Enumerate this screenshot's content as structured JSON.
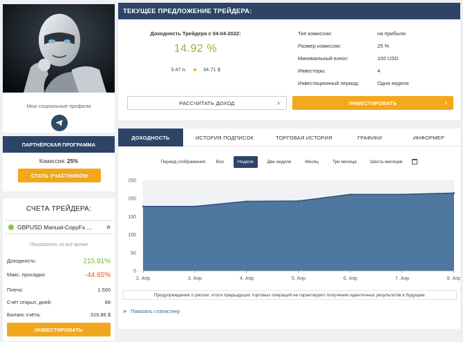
{
  "profile": {
    "social_label": "Мои социальные профили",
    "telegram_icon": "telegram-icon"
  },
  "partner": {
    "title": "ПАРТНЁРСКАЯ ПРОГРАММА",
    "commission_label": "Комиссия:",
    "commission_value": "25%",
    "join_label": "СТАТЬ УЧАСТНИКОМ"
  },
  "accounts": {
    "title": "СЧЕТА ТРЕЙДЕРА:",
    "account_name": "GBPUSD Manual-CopyFx ...",
    "account_arrow": "»",
    "metrics_caption": "Показатели за всё время",
    "metrics": {
      "yield": {
        "label": "Доходность:",
        "value": "215.91%"
      },
      "drawdown": {
        "label": "Макс. просадка:",
        "value": "-44.65%"
      },
      "leverage": {
        "label": "Плечо:",
        "value": "1:500"
      },
      "days": {
        "label": "Счёт открыт, дней:",
        "value": "68"
      },
      "balance": {
        "label": "Баланс счёта:",
        "value": "316.86 $"
      }
    },
    "invest_label": "ИНВЕСТИРОВАТЬ"
  },
  "offer": {
    "title": "ТЕКУЩЕЕ ПРЕДЛОЖЕНИЕ ТРЕЙДЕРА:",
    "yield_label": "Доходность Трейдера с 04-04-2022:",
    "yield_value": "14.92 %",
    "points": "3.47 п.",
    "usd": "34.71 $",
    "details": [
      {
        "k": "Тип комиссии:",
        "v": "на прибыли"
      },
      {
        "k": "Размер комиссии:",
        "v": "25 %"
      },
      {
        "k": "Минимальный взнос:",
        "v": "100 USD"
      },
      {
        "k": "Инвесторы:",
        "v": "4"
      },
      {
        "k": "Инвестиционный период:",
        "v": "Одна неделя"
      }
    ],
    "calc_label": "РАССЧИТАТЬ ДОХОД",
    "invest_label": "ИНВЕСТИРОВАТЬ",
    "chevron": "›"
  },
  "tabs": [
    {
      "label": "ДОХОДНОСТЬ",
      "active": true
    },
    {
      "label": "ИСТОРИЯ ПОДПИСОК",
      "active": false
    },
    {
      "label": "ТОРГОВАЯ ИСТОРИЯ",
      "active": false
    },
    {
      "label": "ГРАФИКИ",
      "active": false
    },
    {
      "label": "ИНФОРМЕР",
      "active": false
    }
  ],
  "periods": {
    "label": "Период отображения:",
    "options": [
      {
        "label": "Все",
        "active": false
      },
      {
        "label": "Неделя",
        "active": true
      },
      {
        "label": "Две недели",
        "active": false
      },
      {
        "label": "Месяц",
        "active": false
      },
      {
        "label": "Три месяца",
        "active": false
      },
      {
        "label": "Шесть месяцев",
        "active": false
      }
    ],
    "calendar_icon": "calendar-icon"
  },
  "chart_data": {
    "type": "area",
    "x": [
      "2. Апр",
      "3. Апр",
      "4. Апр",
      "5. Апр",
      "6. Апр",
      "7. Апр",
      "8. Апр"
    ],
    "values": [
      178,
      178,
      192,
      193,
      211,
      211,
      215
    ],
    "ylim": [
      0,
      250
    ],
    "yticks": [
      0,
      50,
      100,
      150,
      200,
      250
    ],
    "fill_color": "#45719b",
    "line_color": "#2b5177",
    "grid": true
  },
  "warning": "Предупреждение о рисках: итоги предыдущих торговых операций не гарантируют получение идентичных результатов в будущем.",
  "show_stats": "Показать статистику",
  "colors": {
    "navy": "#2d4467",
    "orange": "#f2a81d",
    "green": "#8ab73b",
    "red": "#e05a2b"
  }
}
